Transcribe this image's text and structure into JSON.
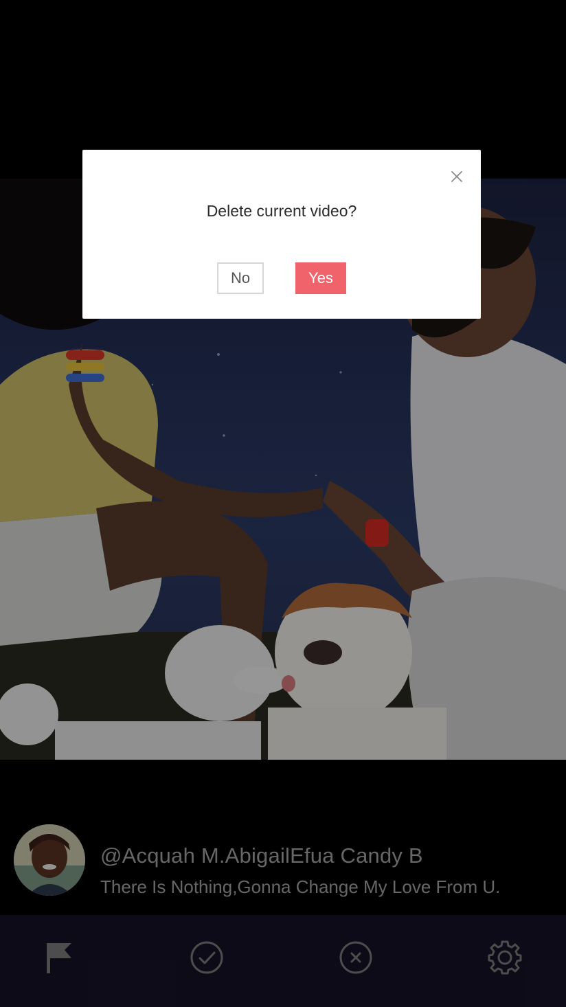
{
  "dialog": {
    "title": "Delete current video?",
    "no_label": "No",
    "yes_label": "Yes",
    "close_icon": "close-icon",
    "yes_color": "#f1636a"
  },
  "author": {
    "name": "@Acquah M.AbigailEfua Candy B",
    "description": "There Is Nothing,Gonna Change My Love From U."
  },
  "toolbar": {
    "items": [
      {
        "icon": "flag-icon"
      },
      {
        "icon": "check-circle-icon"
      },
      {
        "icon": "x-circle-icon"
      },
      {
        "icon": "gear-icon"
      }
    ],
    "background": "#171329"
  }
}
